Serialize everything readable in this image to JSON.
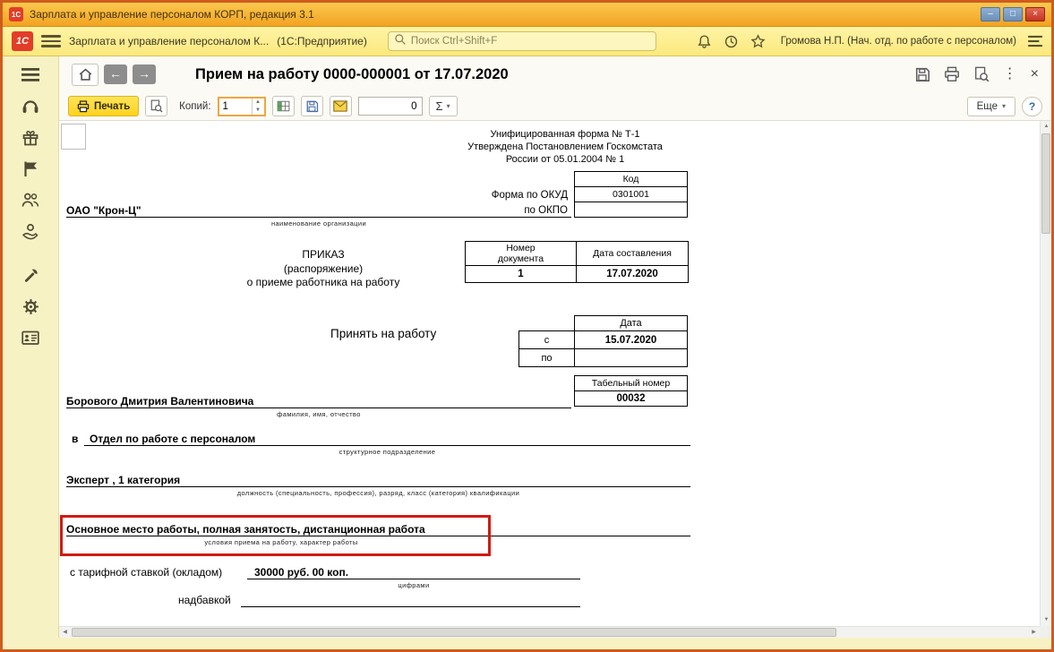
{
  "window": {
    "title": "Зарплата и управление персоналом КОРП, редакция 3.1"
  },
  "glyphs": {
    "minimize": "–",
    "maximize": "□",
    "close": "×",
    "back": "←",
    "forward": "→",
    "more_dots": "⋮",
    "dropdown": "▾",
    "up": "▲",
    "down": "▼",
    "left": "◀",
    "right": "▶"
  },
  "appbar": {
    "logo": "1С",
    "app_title": "Зарплата и управление персоналом К...",
    "platform": "(1С:Предприятие)",
    "search_placeholder": "Поиск Ctrl+Shift+F",
    "user": "Громова Н.П. (Нач. отд. по работе с персоналом)"
  },
  "nav": {
    "title": "Прием на работу 0000-000001 от 17.07.2020"
  },
  "print_toolbar": {
    "print_label": "Печать",
    "copies_label": "Копий:",
    "copies_value": "1",
    "number_value": "0",
    "sigma": "Σ",
    "more_label": "Еще",
    "help": "?"
  },
  "form": {
    "header_lines": [
      "Унифицированная форма № Т-1",
      "Утверждена Постановлением Госкомстата",
      "России от 05.01.2004 № 1"
    ],
    "code_header": "Код",
    "okud_label": "Форма по ОКУД",
    "okud_value": "0301001",
    "okpo_label": "по ОКПО",
    "org_name": "ОАО \"Крон-Ц\"",
    "org_caption": "наименование организации",
    "order_line1": "ПРИКАЗ",
    "order_line2": "(распоряжение)",
    "order_line3": "о приеме работника на работу",
    "num_header": "Номер\nдокумента",
    "date_header": "Дата составления",
    "num_value": "1",
    "date_value": "17.07.2020",
    "hire_label": "Принять на работу",
    "date_col_header": "Дата",
    "from_label": "с",
    "from_value": "15.07.2020",
    "to_label": "по",
    "tab_header": "Табельный номер",
    "tab_value": "00032",
    "employee_name": "Борового Дмитрия Валентиновича",
    "employee_caption": "фамилия, имя, отчество",
    "dept_prefix": "в",
    "dept_name": "Отдел по работе с персоналом",
    "dept_caption": "структурное подразделение",
    "position_name": "Эксперт , 1 категория",
    "position_caption": "должность (специальность, профессия), разряд, класс (категория) квалификации",
    "conditions": "Основное место работы, полная занятость, дистанционная работа",
    "conditions_caption": "условия приема на работу, характер работы",
    "salary_label": "с тарифной ставкой (окладом)",
    "salary_value": "30000 руб. 00 коп.",
    "salary_caption": "цифрами",
    "bonus_label": "надбавкой"
  }
}
